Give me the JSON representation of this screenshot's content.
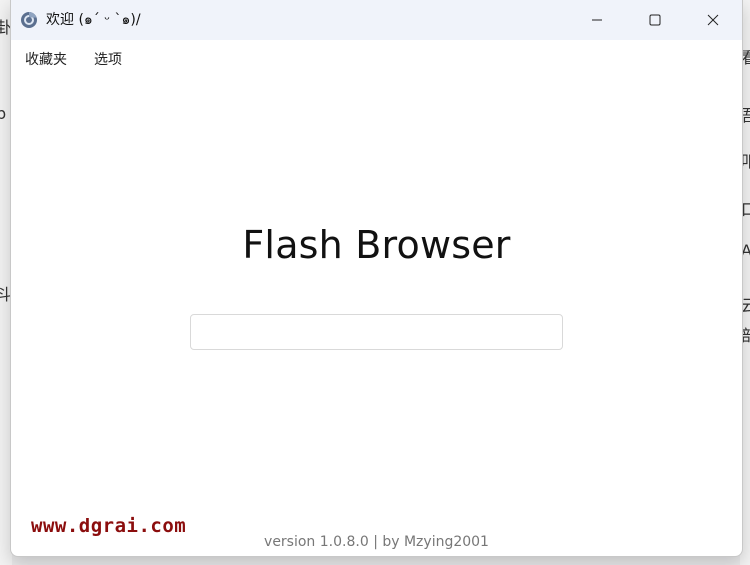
{
  "window": {
    "title": "欢迎 (๑ˊ ᵕ ˋ๑)/",
    "app_icon": "browser-icon",
    "controls": {
      "minimize": "minimize-icon",
      "maximize": "maximize-icon",
      "close": "close-icon"
    }
  },
  "menu": {
    "items": [
      {
        "label": "收藏夹"
      },
      {
        "label": "选项"
      }
    ]
  },
  "main": {
    "title": "Flash Browser",
    "search": {
      "value": "",
      "placeholder": ""
    }
  },
  "footer": {
    "text": "version 1.0.8.0 | by Mzying2001"
  },
  "watermark": {
    "text": "www.dgrai.com",
    "color": "#8b0d0d"
  },
  "background_fragments": {
    "left": [
      "卦",
      "p",
      "斗"
    ],
    "right": [
      "看",
      "吾",
      "叩",
      "口",
      "A",
      "云",
      "部"
    ]
  },
  "colors": {
    "titlebar_bg": "#f0f3fa",
    "window_bg": "#ffffff",
    "input_border": "#d9d9d9"
  }
}
